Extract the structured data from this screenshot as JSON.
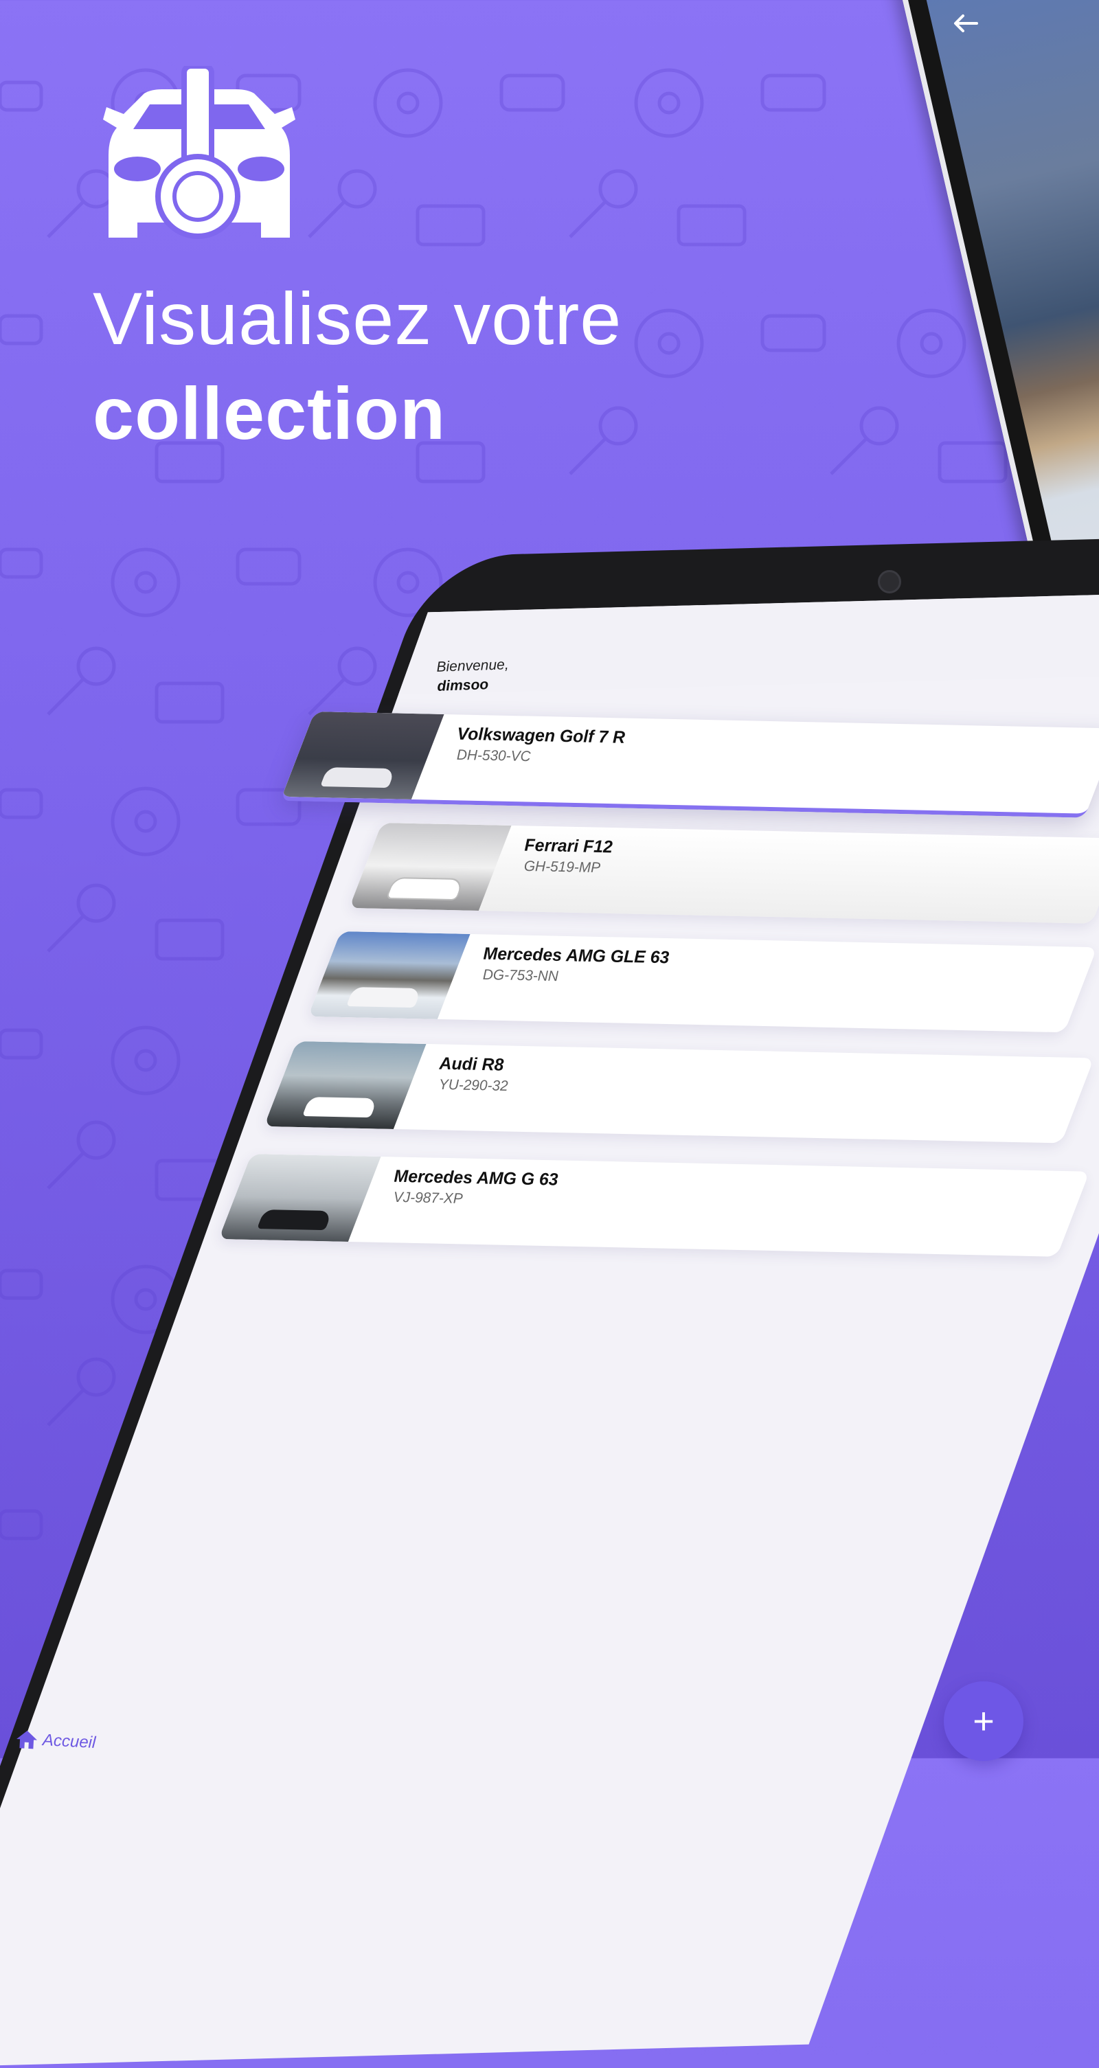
{
  "hero": {
    "title_line1": "Visualisez votre",
    "title_line2": "collection",
    "logo_icon": "car-key-icon"
  },
  "app": {
    "welcome": "Bienvenue,",
    "username": "dimsoo",
    "back_icon": "arrow-left-icon",
    "cars": [
      {
        "name": "Volkswagen Golf 7 R",
        "plate": "DH-530-VC"
      },
      {
        "name": "Ferrari F12",
        "plate": "GH-519-MP"
      },
      {
        "name": "Mercedes AMG GLE 63",
        "plate": "DG-753-NN"
      },
      {
        "name": "Audi R8",
        "plate": "YU-290-32"
      },
      {
        "name": "Mercedes AMG G 63",
        "plate": "VJ-987-XP"
      }
    ],
    "nav": {
      "home_label": "Accueil",
      "home_icon": "home-icon"
    },
    "fab": {
      "label": "+",
      "icon": "plus-icon"
    }
  },
  "colors": {
    "background": "#7d65ec",
    "accent": "#6e57e6",
    "card": "#ffffff",
    "screen": "#f3f2f8"
  }
}
